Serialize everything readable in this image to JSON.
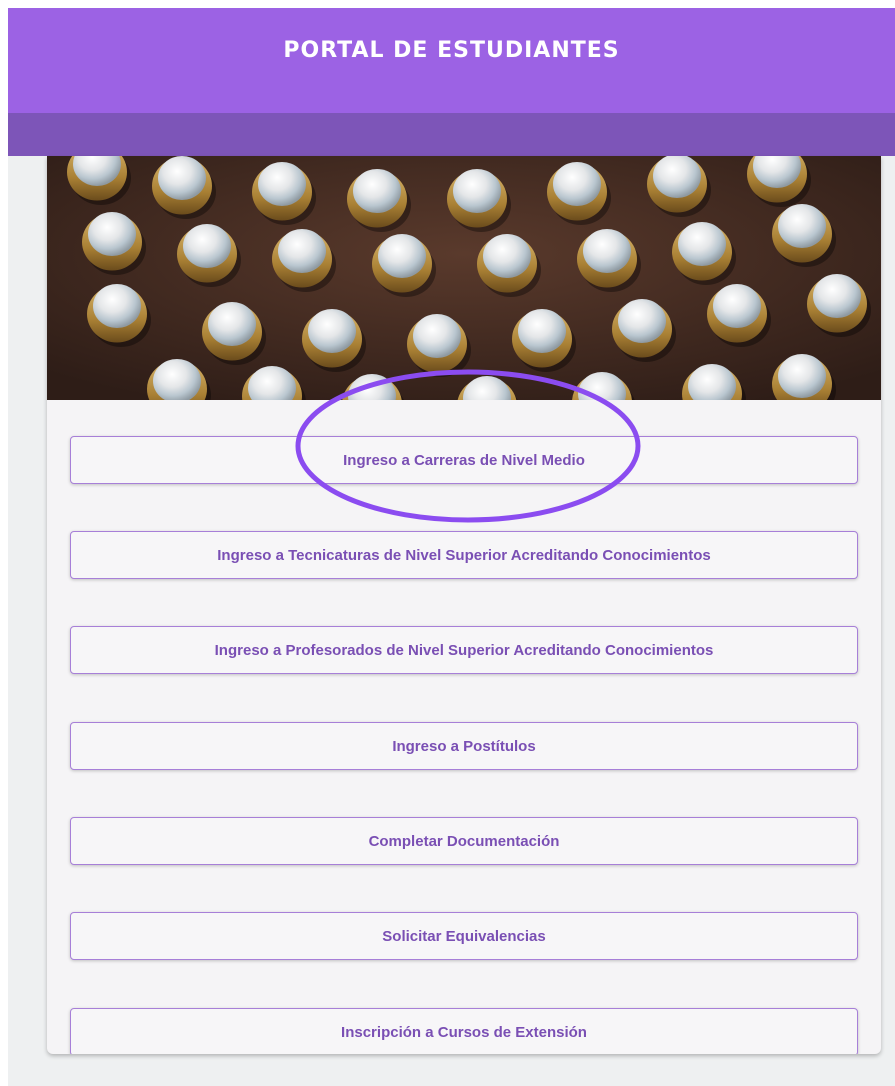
{
  "header": {
    "title": "PORTAL DE ESTUDIANTES"
  },
  "banner": {
    "description_icon": "accordion-buttons-image"
  },
  "menu": {
    "items": [
      {
        "label": "Ingreso a Carreras de Nivel Medio"
      },
      {
        "label": "Ingreso a Tecnicaturas de Nivel Superior Acreditando Conocimientos"
      },
      {
        "label": "Ingreso a Profesorados de Nivel Superior Acreditando Conocimientos"
      },
      {
        "label": "Ingreso a Postítulos"
      },
      {
        "label": "Completar Documentación"
      },
      {
        "label": "Solicitar Equivalencias"
      },
      {
        "label": "Inscripción a Cursos de Extensión"
      }
    ]
  },
  "colors": {
    "header": "#9c62e4",
    "header_band": "#7d55b8",
    "button_text": "#7a4fb4",
    "highlight": "#8b4cf0"
  }
}
